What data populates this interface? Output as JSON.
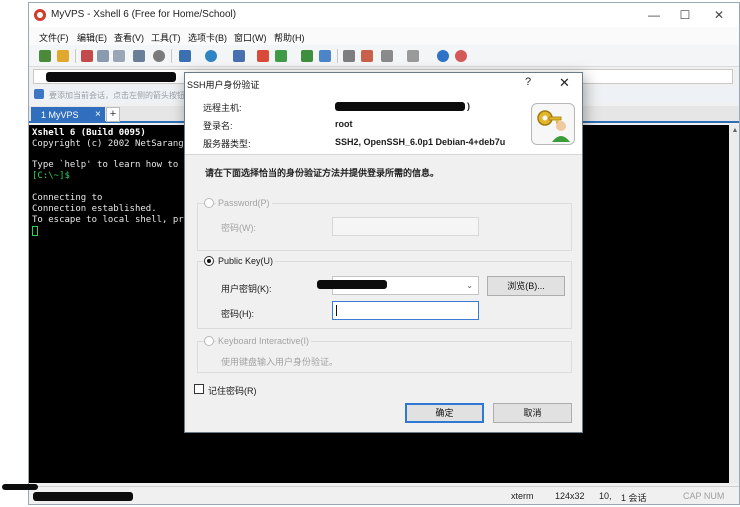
{
  "window": {
    "title": "MyVPS - Xshell 6 (Free for Home/School)",
    "minimize_glyph": "—",
    "maximize_glyph": "☐",
    "close_glyph": "✕"
  },
  "menu": [
    "文件(F)",
    "编辑(E)",
    "查看(V)",
    "工具(T)",
    "选项卡(B)",
    "窗口(W)",
    "帮助(H)"
  ],
  "tipbar": {
    "text": "要添加当前会话，点击左侧的箭头按钮。"
  },
  "tabs": {
    "active_label": "1 MyVPS",
    "close_glyph": "×",
    "add_glyph": "+"
  },
  "terminal": {
    "lines": [
      "Xshell 6 (Build 0095)",
      "Copyright (c) 2002 NetSarang",
      "",
      "Type `help' to learn how to",
      "[C:\\~]$",
      "",
      "Connecting to",
      "Connection established.",
      "To escape to local shell, pr"
    ]
  },
  "status": {
    "terminal_type": "xterm",
    "size": "124x32",
    "cursor_pos": "10,",
    "sessions": "1 会话",
    "caps": "CAP NUM"
  },
  "dialog": {
    "title": "SSH用户身份验证",
    "help_glyph": "?",
    "close_glyph": "✕",
    "remote_host_label": "远程主机:",
    "remote_host_suffix": ")",
    "login_label": "登录名:",
    "login_value": "root",
    "server_type_label": "服务器类型:",
    "server_type_value": "SSH2, OpenSSH_6.0p1 Debian-4+deb7u",
    "instruction": "请在下面选择恰当的身份验证方法并提供登录所需的信息。",
    "password_option": "Password(P)",
    "password_field_label": "密码(W):",
    "public_key_option": "Public Key(U)",
    "user_key_label": "用户密钥(K):",
    "browse_button": "浏览(B)...",
    "passphrase_label": "密码(H):",
    "keyboard_option": "Keyboard Interactive(I)",
    "keyboard_hint": "使用键盘输入用户身份验证。",
    "remember_label": "记住密码(R)",
    "ok_button": "确定",
    "cancel_button": "取消"
  },
  "colors": {
    "tab_active": "#2f6fbd",
    "terminal_bg": "#000000",
    "prompt_green": "#28d35a",
    "focus_blue": "#3a7bd5"
  }
}
